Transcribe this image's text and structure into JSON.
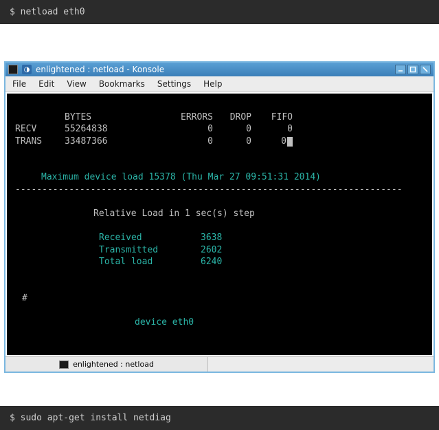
{
  "top_shell": {
    "prompt": "$",
    "command": "netload eth0"
  },
  "window": {
    "title": "enlightened : netload - Konsole",
    "menu": [
      "File",
      "Edit",
      "View",
      "Bookmarks",
      "Settings",
      "Help"
    ],
    "status_tab": "enlightened : netload"
  },
  "terminal": {
    "headers": {
      "bytes": "BYTES",
      "errors": "ERRORS",
      "drop": "DROP",
      "fifo": "FIFO"
    },
    "rows": [
      {
        "label": "RECV",
        "bytes": "55264838",
        "errors": "0",
        "drop": "0",
        "fifo": "0"
      },
      {
        "label": "TRANS",
        "bytes": "33487366",
        "errors": "0",
        "drop": "0",
        "fifo": "0"
      }
    ],
    "max_line": "Maximum device load 15378 (Thu Mar 27 09:51:31 2014)",
    "dashes": "------------------------------------------------------------------------",
    "rel_title": "Relative Load in 1 sec(s) step",
    "relative": [
      {
        "label": "Received",
        "value": "3638"
      },
      {
        "label": "Transmitted",
        "value": "2602"
      },
      {
        "label": "Total load",
        "value": "6240"
      }
    ],
    "hash": "#",
    "device": "device eth0"
  },
  "bottom_shell": {
    "prompt": "$",
    "command": "sudo apt-get install netdiag"
  },
  "chart_data": {
    "type": "table",
    "title": "netload eth0 output",
    "columns": [
      "",
      "BYTES",
      "ERRORS",
      "DROP",
      "FIFO"
    ],
    "rows": [
      [
        "RECV",
        55264838,
        0,
        0,
        0
      ],
      [
        "TRANS",
        33487366,
        0,
        0,
        0
      ]
    ],
    "max_device_load": 15378,
    "max_load_timestamp": "Thu Mar 27 09:51:31 2014",
    "relative_load_step_sec": 1,
    "relative_load": {
      "Received": 3638,
      "Transmitted": 2602,
      "Total load": 6240
    },
    "device": "eth0"
  }
}
